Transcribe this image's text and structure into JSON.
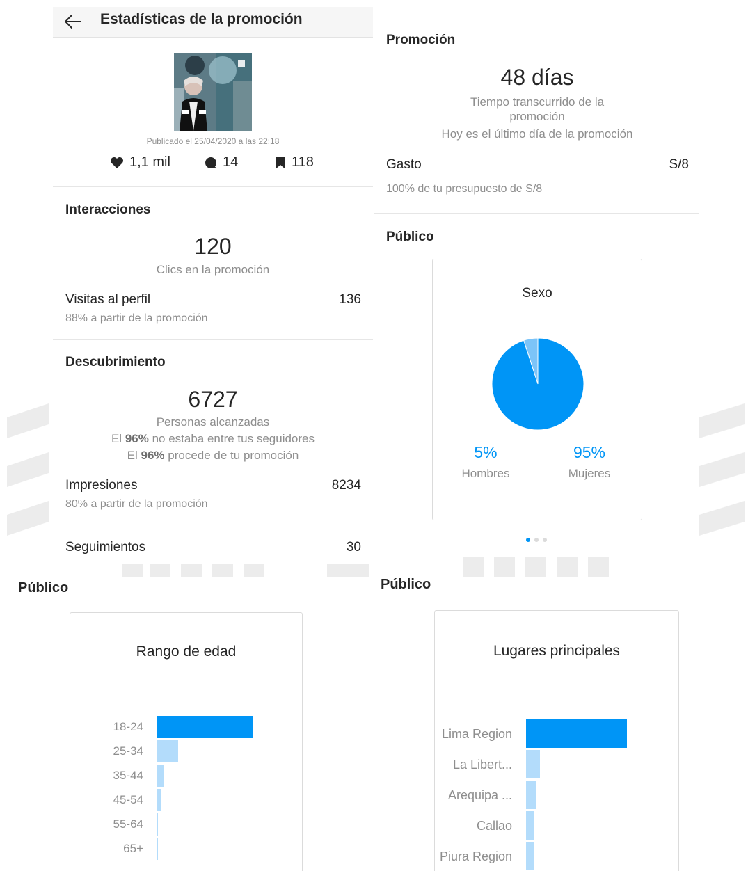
{
  "header": {
    "title": "Estadísticas de la promoción"
  },
  "post": {
    "published": "Publicado el 25/04/2020 a las 22:18",
    "likes": "1,1 mil",
    "comments": "14",
    "saves": "118"
  },
  "interactions": {
    "title": "Interacciones",
    "clicks_value": "120",
    "clicks_label": "Clics en la promoción",
    "profile_visits_label": "Visitas al perfil",
    "profile_visits_value": "136",
    "profile_visits_sub": "88% a partir de la promoción"
  },
  "discovery": {
    "title": "Descubrimiento",
    "reach_value": "6727",
    "reach_label": "Personas alcanzadas",
    "not_followers_pre": "El ",
    "not_followers_pct": "96%",
    "not_followers_post": " no estaba entre tus seguidores",
    "from_promo_pre": "El ",
    "from_promo_pct": "96%",
    "from_promo_post": " procede de tu promoción",
    "impressions_label": "Impresiones",
    "impressions_value": "8234",
    "impressions_sub": "80% a partir de la promoción",
    "follows_label": "Seguimientos",
    "follows_value": "30"
  },
  "promotion": {
    "title": "Promoción",
    "days_value": "48 días",
    "elapsed_label_1": "Tiempo transcurrido de la",
    "elapsed_label_2": "promoción",
    "last_day": "Hoy es el último día de la promoción",
    "spend_label": "Gasto",
    "spend_value": "S/8",
    "spend_sub": "100% de tu presupuesto de S/8"
  },
  "audience": {
    "title": "Público",
    "gender_title": "Sexo",
    "men_pct": "5%",
    "men_label": "Hombres",
    "women_pct": "95%",
    "women_label": "Mujeres",
    "carousel_active_index": 0,
    "carousel_count": 3
  },
  "age": {
    "section_title": "Público",
    "card_title": "Rango de edad",
    "labels": [
      "18-24",
      "25-34",
      "35-44",
      "45-54",
      "55-64",
      "65+"
    ]
  },
  "places": {
    "section_title": "Público",
    "card_title": "Lugares principales",
    "labels": [
      "Lima Region",
      "La Libert...",
      "Arequipa ...",
      "Callao",
      "Piura Region"
    ]
  },
  "colors": {
    "primary_bar": "#0095f6",
    "light_bar": "#b3dcfb",
    "pie_main": "#0095f6",
    "pie_minor": "#7cc4f8"
  },
  "chart_data": [
    {
      "type": "pie",
      "title": "Sexo",
      "categories": [
        "Hombres",
        "Mujeres"
      ],
      "values": [
        5,
        95
      ]
    },
    {
      "type": "bar",
      "title": "Rango de edad",
      "categories": [
        "18-24",
        "25-34",
        "35-44",
        "45-54",
        "55-64",
        "65+"
      ],
      "values": [
        100,
        22,
        7,
        4,
        1,
        1
      ]
    },
    {
      "type": "bar",
      "title": "Lugares principales",
      "categories": [
        "Lima Region",
        "La Libert...",
        "Arequipa ...",
        "Callao",
        "Piura Region"
      ],
      "values": [
        100,
        14,
        10,
        8,
        8
      ]
    }
  ]
}
